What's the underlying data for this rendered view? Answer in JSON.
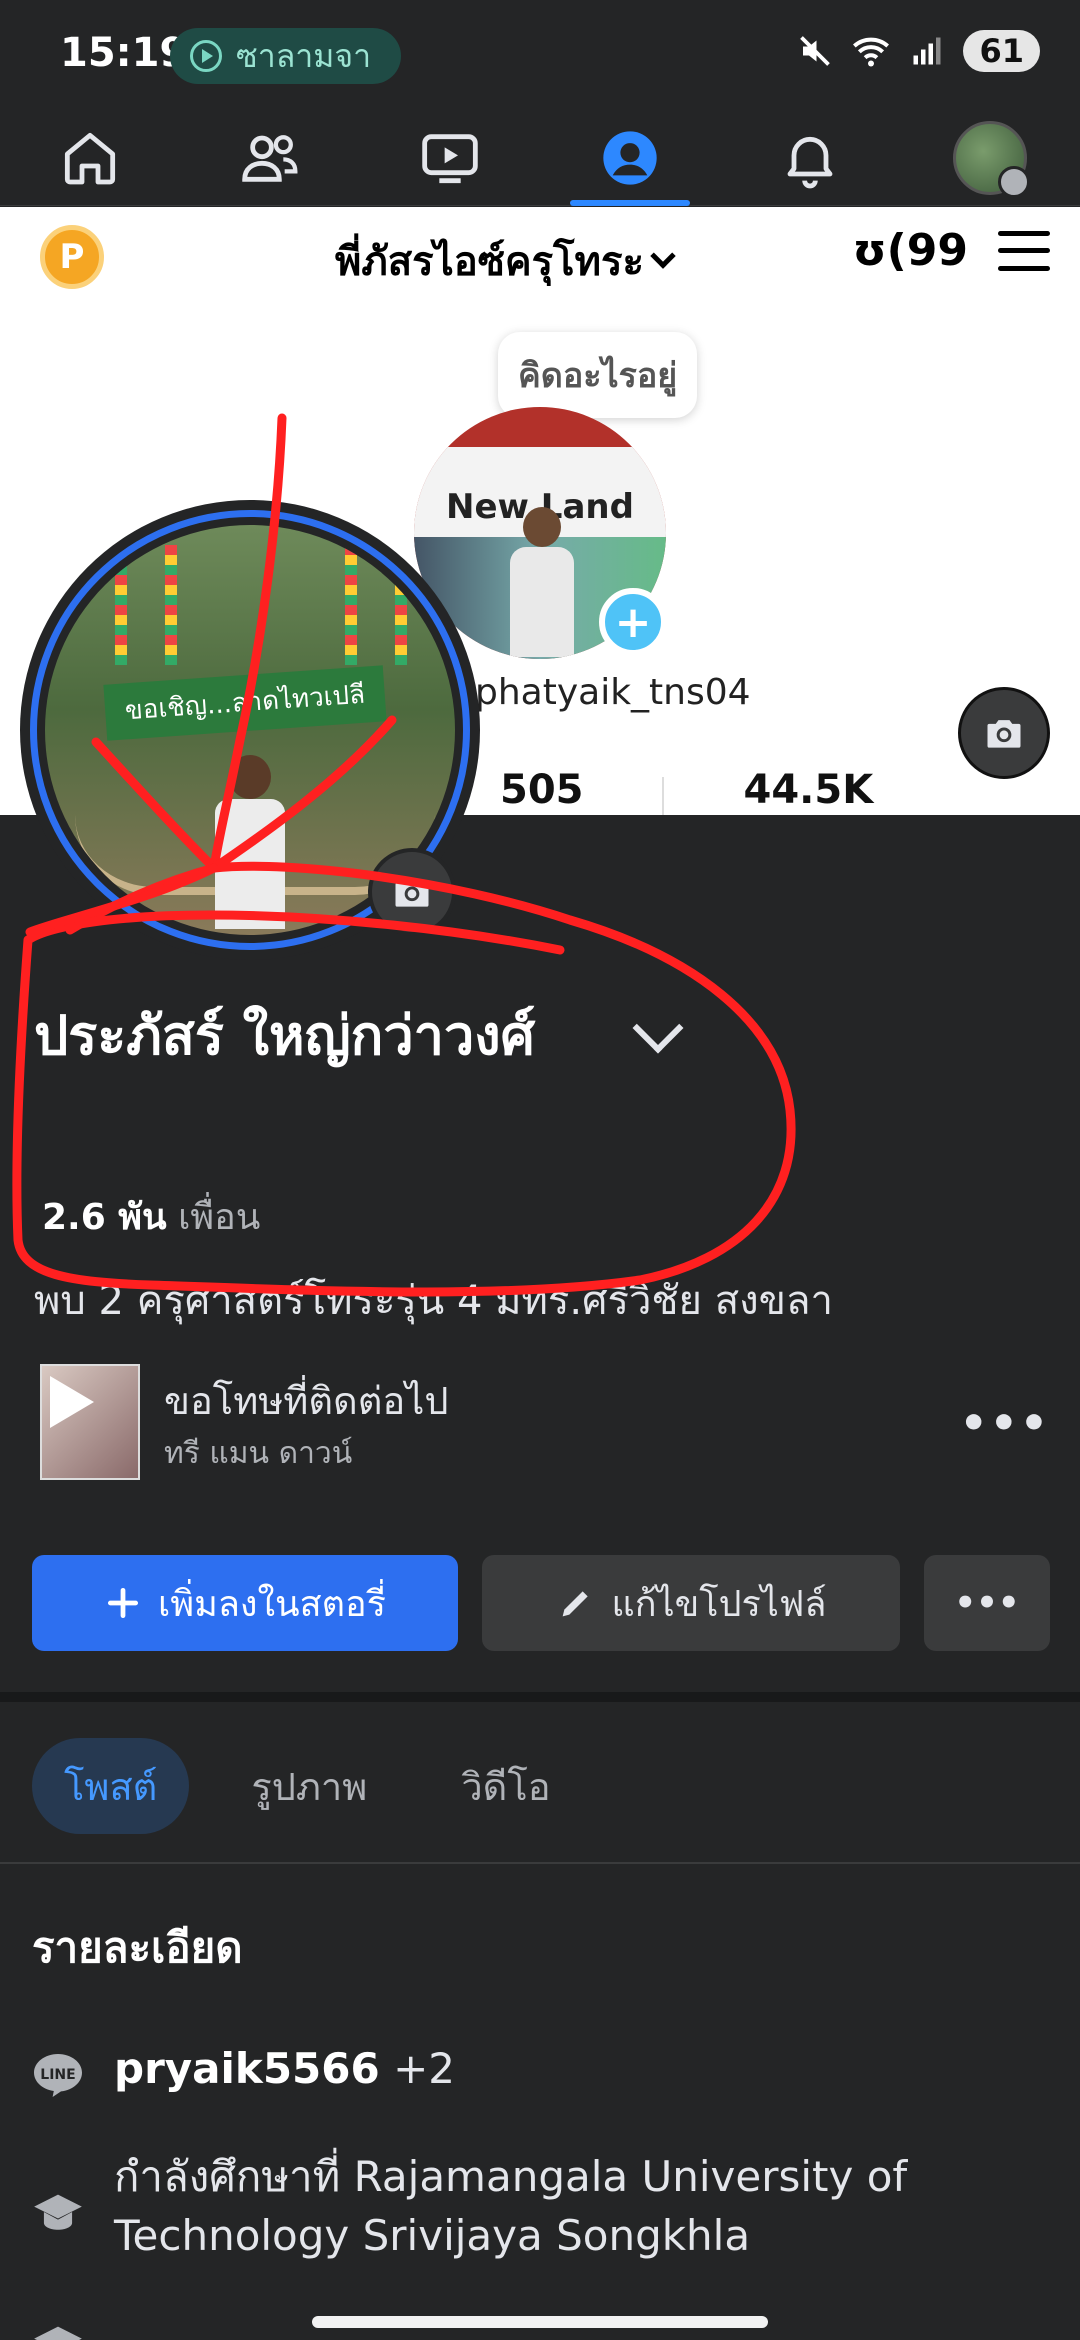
{
  "status_bar": {
    "time": "15:19",
    "media_pill_text": "ซาลามจา",
    "battery": "61"
  },
  "top_nav": {
    "items": [
      {
        "icon": "home-icon"
      },
      {
        "icon": "friends-icon"
      },
      {
        "icon": "video-icon"
      },
      {
        "icon": "profile-icon",
        "active": true
      },
      {
        "icon": "bell-icon"
      },
      {
        "icon": "avatar"
      }
    ]
  },
  "cover": {
    "coin_letter": "P",
    "account_title": "พี่ภัสรไอซ์ครุโทระ",
    "brand_logo": "ʊ(99",
    "thought_bubble": "คิดอะไรอยู่",
    "sign_text": "New Land",
    "ig_username": "phatyaik_tns04",
    "stats": [
      "505",
      "44.5K"
    ]
  },
  "profile": {
    "name": "ประภัสร์ ใหญ่กว่าวงศ์",
    "friends_count": "2.6 พัน",
    "friends_label": "เพื่อน",
    "bio": "พบ 2 ครุศาสตร์โทระรุ่น 4 มทร.ศรีวิชัย สงขลา",
    "banner_text": "ขอเชิญ...ลาดไทวเปลี"
  },
  "music": {
    "title": "ขอโทษที่ติดต่อไป",
    "artist": "ทรี แมน ดาวน์",
    "more": "•••"
  },
  "actions": {
    "add_story": "เพิ่มลงในสตอรี่",
    "edit_profile": "แก้ไขโปรไฟล์",
    "more": "•••"
  },
  "tabs": [
    "โพสต์",
    "รูปภาพ",
    "วิดีโอ"
  ],
  "details": {
    "title": "รายละเอียด",
    "line_id": "pryaik5566",
    "line_extra": "+2",
    "education": "กำลังศึกษาที่ Rajamangala University of Technology Srivijaya Songkhla"
  },
  "colors": {
    "accent_blue": "#2d6ff0",
    "annotation_red": "#ff2020"
  }
}
